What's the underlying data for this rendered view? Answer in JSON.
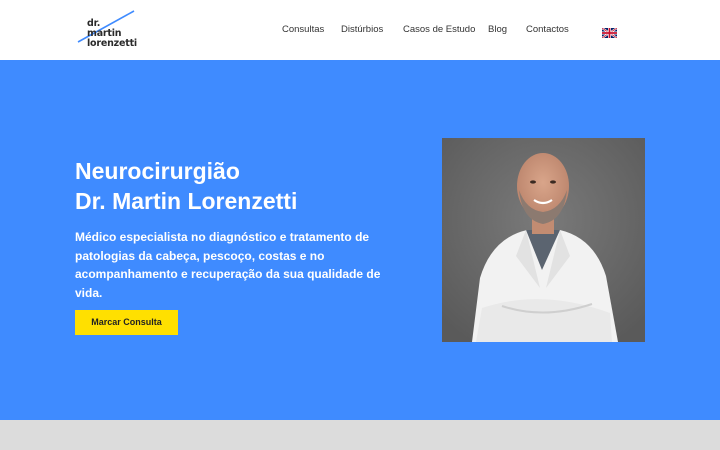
{
  "logo": {
    "line1": "dr.",
    "line2": "martin",
    "line3": "lorenzetti",
    "accent_color": "#3f8bff"
  },
  "nav": {
    "items": [
      {
        "label": "Consultas"
      },
      {
        "label": "Distúrbios"
      },
      {
        "label": "Casos de Estudo"
      },
      {
        "label": "Blog"
      },
      {
        "label": "Contactos"
      }
    ],
    "language_flag": "uk-flag-icon"
  },
  "hero": {
    "background_color": "#3f8bff",
    "title_line1": "Neurocirurgião",
    "title_line2": "Dr. Martin Lorenzetti",
    "description": "Médico especialista no diagnóstico e tratamento de patologias da cabeça, pescoço, costas e no acompanhamento e recuperação da sua qualidade de vida.",
    "cta_label": "Marcar Consulta",
    "cta_color": "#ffe000"
  }
}
